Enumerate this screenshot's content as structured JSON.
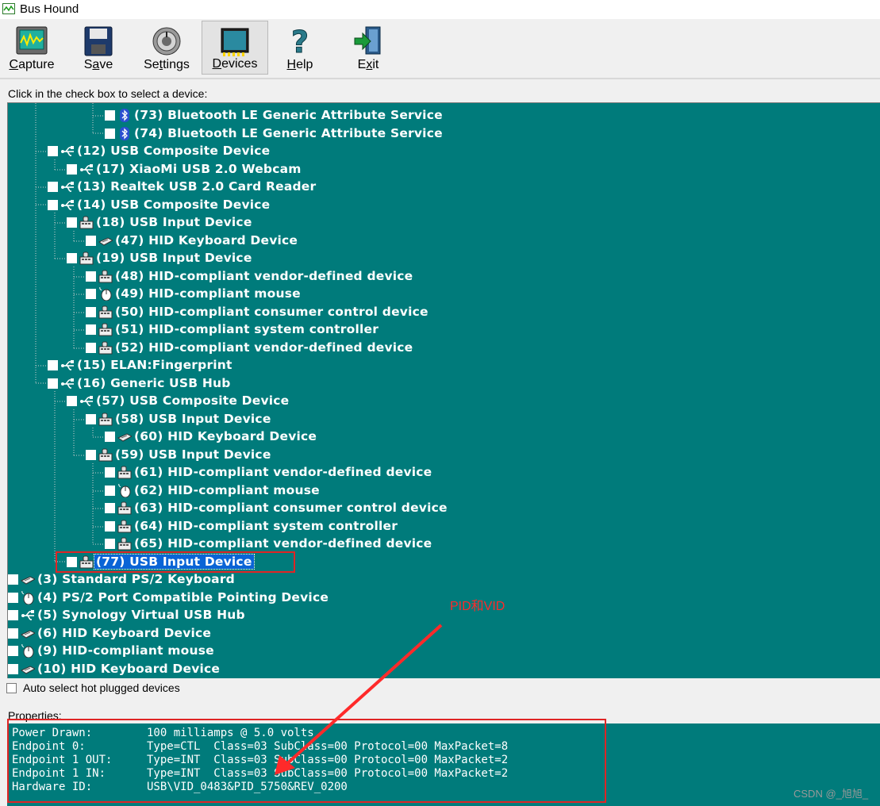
{
  "window": {
    "title": "Bus Hound"
  },
  "toolbar": {
    "buttons": [
      {
        "label": "Capture",
        "icon": "capture-icon"
      },
      {
        "label": "Save",
        "icon": "save-icon"
      },
      {
        "label": "Settings",
        "icon": "settings-icon"
      },
      {
        "label": "Devices",
        "icon": "devices-icon"
      },
      {
        "label": "Help",
        "icon": "help-icon"
      },
      {
        "label": "Exit",
        "icon": "exit-icon"
      }
    ]
  },
  "devices": {
    "hint": "Click in the check box to select a device:",
    "items": [
      {
        "label": "(73) Bluetooth LE Generic Attribute Service",
        "icon": "bluetooth-icon"
      },
      {
        "label": "(74) Bluetooth LE Generic Attribute Service",
        "icon": "bluetooth-icon"
      },
      {
        "label": "(12) USB Composite Device",
        "icon": "usb-icon"
      },
      {
        "label": "(17) XiaoMi USB 2.0 Webcam",
        "icon": "usb-icon"
      },
      {
        "label": "(13) Realtek USB 2.0 Card Reader",
        "icon": "usb-icon"
      },
      {
        "label": "(14) USB Composite Device",
        "icon": "usb-icon"
      },
      {
        "label": "(18) USB Input Device",
        "icon": "input-device-icon"
      },
      {
        "label": "(47) HID Keyboard Device",
        "icon": "keyboard-icon"
      },
      {
        "label": "(19) USB Input Device",
        "icon": "input-device-icon"
      },
      {
        "label": "(48) HID-compliant vendor-defined device",
        "icon": "input-device-icon"
      },
      {
        "label": "(49) HID-compliant mouse",
        "icon": "mouse-icon"
      },
      {
        "label": "(50) HID-compliant consumer control device",
        "icon": "input-device-icon"
      },
      {
        "label": "(51) HID-compliant system controller",
        "icon": "input-device-icon"
      },
      {
        "label": "(52) HID-compliant vendor-defined device",
        "icon": "input-device-icon"
      },
      {
        "label": "(15) ELAN:Fingerprint",
        "icon": "usb-icon"
      },
      {
        "label": "(16) Generic USB Hub",
        "icon": "usb-icon"
      },
      {
        "label": "(57) USB Composite Device",
        "icon": "usb-icon"
      },
      {
        "label": "(58) USB Input Device",
        "icon": "input-device-icon"
      },
      {
        "label": "(60) HID Keyboard Device",
        "icon": "keyboard-icon"
      },
      {
        "label": "(59) USB Input Device",
        "icon": "input-device-icon"
      },
      {
        "label": "(61) HID-compliant vendor-defined device",
        "icon": "input-device-icon"
      },
      {
        "label": "(62) HID-compliant mouse",
        "icon": "mouse-icon"
      },
      {
        "label": "(63) HID-compliant consumer control device",
        "icon": "input-device-icon"
      },
      {
        "label": "(64) HID-compliant system controller",
        "icon": "input-device-icon"
      },
      {
        "label": "(65) HID-compliant vendor-defined device",
        "icon": "input-device-icon"
      },
      {
        "label": "(77) USB Input Device",
        "icon": "input-device-icon",
        "selected": true
      },
      {
        "label": "(3) Standard PS/2 Keyboard",
        "icon": "keyboard-icon"
      },
      {
        "label": "(4) PS/2 Port Compatible Pointing Device",
        "icon": "mouse-icon"
      },
      {
        "label": "(5) Synology Virtual USB Hub",
        "icon": "usb-icon"
      },
      {
        "label": "(6) HID Keyboard Device",
        "icon": "keyboard-icon"
      },
      {
        "label": "(9) HID-compliant mouse",
        "icon": "mouse-icon"
      },
      {
        "label": "(10) HID Keyboard Device",
        "icon": "keyboard-icon"
      }
    ]
  },
  "auto_select": {
    "label": "Auto select hot plugged devices",
    "checked": false
  },
  "properties": {
    "label": "Properties:",
    "rows": [
      {
        "key": "Power Drawn:",
        "value": "100 milliamps @ 5.0 volts"
      },
      {
        "key": "Endpoint 0:",
        "value": "Type=CTL  Class=03 SubClass=00 Protocol=00 MaxPacket=8"
      },
      {
        "key": "Endpoint 1 OUT:",
        "value": "Type=INT  Class=03 SubClass=00 Protocol=00 MaxPacket=2"
      },
      {
        "key": "Endpoint 1 IN:",
        "value": "Type=INT  Class=03 SubClass=00 Protocol=00 MaxPacket=2"
      },
      {
        "key": "Hardware ID:",
        "value": "USB\\VID_0483&PID_5750&REV_0200"
      }
    ]
  },
  "annotation": {
    "text": "PID和VID",
    "color": "#ff2a2a"
  },
  "watermark": "CSDN @_旭旭_",
  "colors": {
    "tree_bg": "#007b7b",
    "selection": "#0a64d6",
    "highlight_box": "#e02525"
  }
}
